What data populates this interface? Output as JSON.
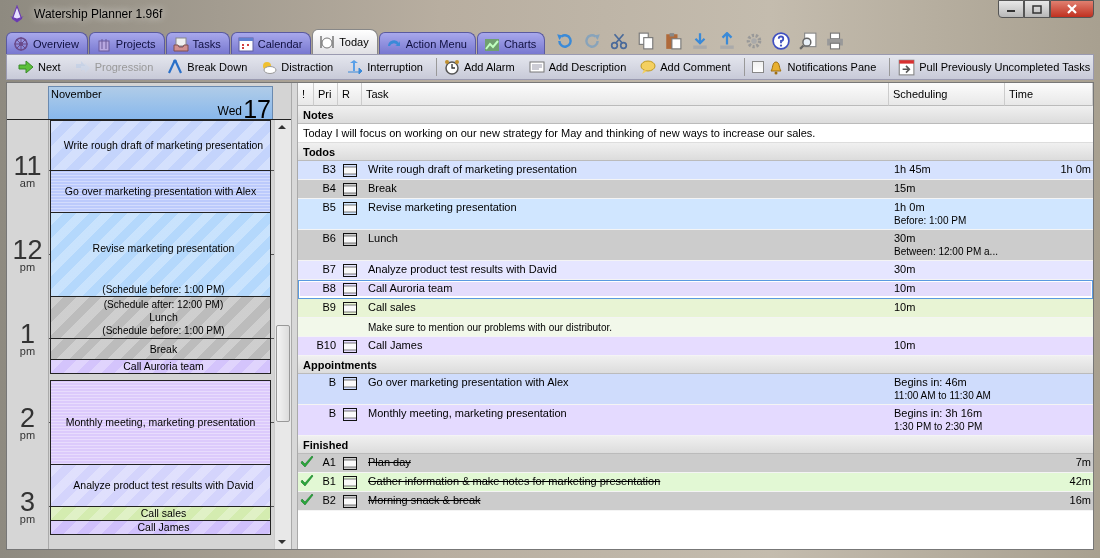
{
  "window": {
    "title": "Watership Planner 1.96f"
  },
  "tabs": [
    {
      "label": "Overview",
      "selected": false
    },
    {
      "label": "Projects",
      "selected": false
    },
    {
      "label": "Tasks",
      "selected": false
    },
    {
      "label": "Calendar",
      "selected": false
    },
    {
      "label": "Today",
      "selected": true
    },
    {
      "label": "Action Menu",
      "selected": false
    },
    {
      "label": "Charts",
      "selected": false
    }
  ],
  "quick_tools": [
    {
      "disabled": false
    },
    {
      "disabled": true
    },
    {
      "disabled": false
    },
    {
      "disabled": false
    },
    {
      "disabled": false
    },
    {
      "disabled": false
    },
    {
      "disabled": false
    },
    {
      "disabled": false
    },
    {
      "disabled": false
    },
    {
      "disabled": false
    },
    {
      "disabled": false
    }
  ],
  "toolbar": {
    "groups": [
      [
        {
          "kind": "button",
          "label": "Next",
          "disabled": false
        },
        {
          "kind": "button",
          "label": "Progression",
          "disabled": true
        },
        {
          "kind": "button",
          "label": "Break Down",
          "disabled": false
        },
        {
          "kind": "button",
          "label": "Distraction",
          "disabled": false
        },
        {
          "kind": "button",
          "label": "Interruption",
          "disabled": false
        }
      ],
      [
        {
          "kind": "button",
          "label": "Add Alarm",
          "disabled": false
        },
        {
          "kind": "button",
          "label": "Add Description",
          "disabled": false
        },
        {
          "kind": "button",
          "label": "Add Comment",
          "disabled": false
        }
      ],
      [
        {
          "kind": "checkbox",
          "label": "Notifications Pane",
          "disabled": false,
          "checked": false
        }
      ],
      [
        {
          "kind": "button",
          "label": "Pull Previously Uncompleted Tasks",
          "disabled": false
        }
      ]
    ]
  },
  "calendar": {
    "month": "November",
    "weekday": "Wed",
    "day": "17",
    "hours": [
      {
        "hour": "11",
        "period": "am"
      },
      {
        "hour": "12",
        "period": "pm"
      },
      {
        "hour": "1",
        "period": "pm"
      },
      {
        "hour": "2",
        "period": "pm"
      },
      {
        "hour": "3",
        "period": "pm"
      }
    ],
    "events": [
      {
        "title": "Write rough draft of marketing presentation",
        "kind": "task",
        "color": "#c4d4fc"
      },
      {
        "title": "Go over marketing presentation with Alex",
        "kind": "appointment",
        "color": "#bccafc"
      },
      {
        "title": "Revise marketing presentation",
        "kind": "task",
        "color": "#b4d8fc",
        "note_bottom": "(Schedule before: 1:00 PM)"
      },
      {
        "title": "Lunch",
        "kind": "task",
        "color": "#bcbcbc",
        "note_top": "(Schedule after: 12:00 PM)",
        "note_bottom": "(Schedule before: 1:00 PM)"
      },
      {
        "title": "Break",
        "kind": "task",
        "color": "#bcbcbc"
      },
      {
        "title": "Call Auroria team",
        "kind": "task",
        "color": "#d4c4fc"
      },
      {
        "title": "Monthly meeting, marketing presentation",
        "kind": "appointment",
        "color": "#dccafc"
      },
      {
        "title": "Analyze product test results with David",
        "kind": "task",
        "color": "#d4d4fc"
      },
      {
        "title": "Call sales",
        "kind": "task",
        "color": "#d4ecb0"
      },
      {
        "title": "Call James",
        "kind": "task",
        "color": "#d0c0fc"
      }
    ]
  },
  "table": {
    "columns": [
      "!",
      "Pri",
      "R",
      "Task",
      "Scheduling",
      "Time"
    ],
    "sections": [
      {
        "title": "Notes",
        "kind": "notes",
        "text": "Today I will focus on working on our new strategy for May and thinking of new ways to increase our sales."
      },
      {
        "title": "Todos",
        "kind": "tasks",
        "rows": [
          {
            "pri": "B3",
            "task": "Write rough draft of marketing presentation",
            "scheduling": "1h 45m",
            "time": "1h 0m",
            "color": "#d6e2fe",
            "selected": false,
            "done": false
          },
          {
            "pri": "B4",
            "task": "Break",
            "scheduling": "15m",
            "color": "#cccccc",
            "selected": false,
            "done": false
          },
          {
            "pri": "B5",
            "task": "Revise marketing presentation",
            "scheduling": "1h 0m",
            "scheduling_detail": "Before: 1:00 PM",
            "color": "#d0e6ff",
            "selected": false,
            "done": false
          },
          {
            "pri": "B6",
            "task": "Lunch",
            "scheduling": "30m",
            "scheduling_detail": "Between: 12:00 PM a...",
            "color": "#cccccc",
            "selected": false,
            "done": false
          },
          {
            "pri": "B7",
            "task": "Analyze product test results with David",
            "scheduling": "30m",
            "color": "#e6e6ff",
            "selected": false,
            "done": false
          },
          {
            "pri": "B8",
            "task": "Call Auroria team",
            "scheduling": "10m",
            "color": "#e4dcfc",
            "selected": true,
            "done": false
          },
          {
            "pri": "B9",
            "task": "Call sales",
            "scheduling": "10m",
            "color": "#e8f4d4",
            "selected": false,
            "done": false,
            "note": "Make sure to mention our problems with our distributor."
          },
          {
            "pri": "B10",
            "task": "Call James",
            "scheduling": "10m",
            "color": "#e6dcff",
            "selected": false,
            "done": false
          }
        ]
      },
      {
        "title": "Appointments",
        "kind": "tasks",
        "rows": [
          {
            "pri": "B",
            "task": "Go over marketing presentation with Alex",
            "scheduling": "Begins in: 46m",
            "scheduling_detail": "11:00 AM to 11:30 AM",
            "color": "#cfdcfc",
            "selected": false,
            "done": false
          },
          {
            "pri": "B",
            "task": "Monthly meeting, marketing presentation",
            "scheduling": "Begins in: 3h 16m",
            "scheduling_detail": "1:30 PM to 2:30 PM",
            "color": "#e4daff",
            "selected": false,
            "done": false
          }
        ]
      },
      {
        "title": "Finished",
        "kind": "tasks",
        "rows": [
          {
            "pri": "A1",
            "task": "Plan day",
            "time": "7m",
            "color": "#cccccc",
            "selected": false,
            "done": true
          },
          {
            "pri": "B1",
            "task": "Gather information & make notes for marketing presentation",
            "time": "42m",
            "color": "#e2f8d4",
            "selected": false,
            "done": true
          },
          {
            "pri": "B2",
            "task": "Morning snack & break",
            "time": "16m",
            "color": "#cccccc",
            "selected": false,
            "done": true
          }
        ]
      }
    ]
  }
}
